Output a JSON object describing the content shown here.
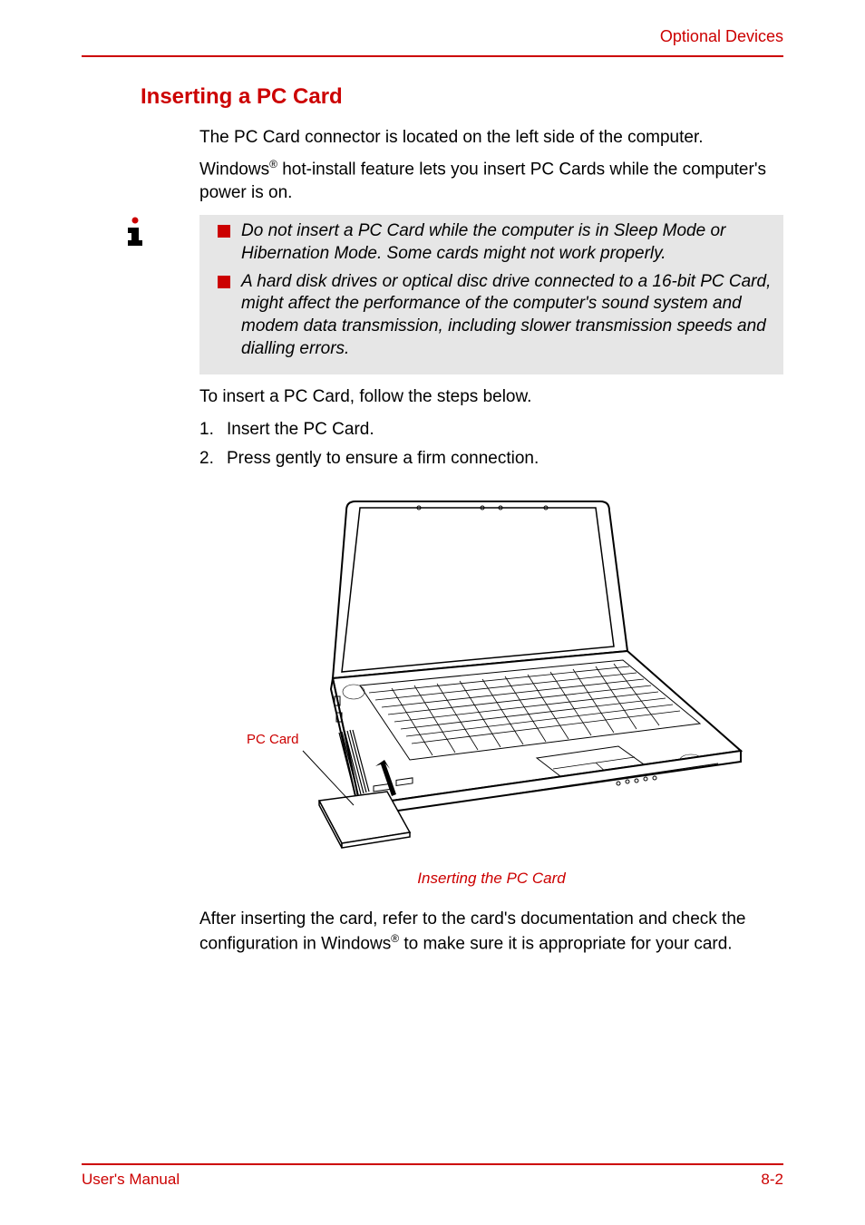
{
  "header": {
    "breadcrumb": "Optional Devices"
  },
  "section": {
    "title": "Inserting a PC Card",
    "intro1": "The PC Card connector is located on the left side of the computer.",
    "intro2_pre": "Windows",
    "intro2_sup": "®",
    "intro2_post": " hot-install feature lets you insert PC Cards while the computer's power is on."
  },
  "notes": {
    "item1": "Do not insert a PC Card while the computer is in Sleep Mode or Hibernation Mode. Some cards might not work properly.",
    "item2": "A hard disk drives or optical disc drive connected to a 16-bit PC Card, might affect the performance of the computer's sound system and modem data transmission, including slower transmission speeds and dialling errors."
  },
  "steps": {
    "lead": "To insert a PC Card, follow the steps below.",
    "s1_num": "1.",
    "s1_text": "Insert the PC Card.",
    "s2_num": "2.",
    "s2_text": "Press gently to ensure a firm connection."
  },
  "figure": {
    "label": "PC Card",
    "caption": "Inserting the PC Card"
  },
  "closing": {
    "pre": "After inserting the card, refer to the card's documentation and check the configuration in Windows",
    "sup": "®",
    "post": " to make sure it is appropriate for your card."
  },
  "footer": {
    "left": "User's Manual",
    "right": "8-2"
  }
}
